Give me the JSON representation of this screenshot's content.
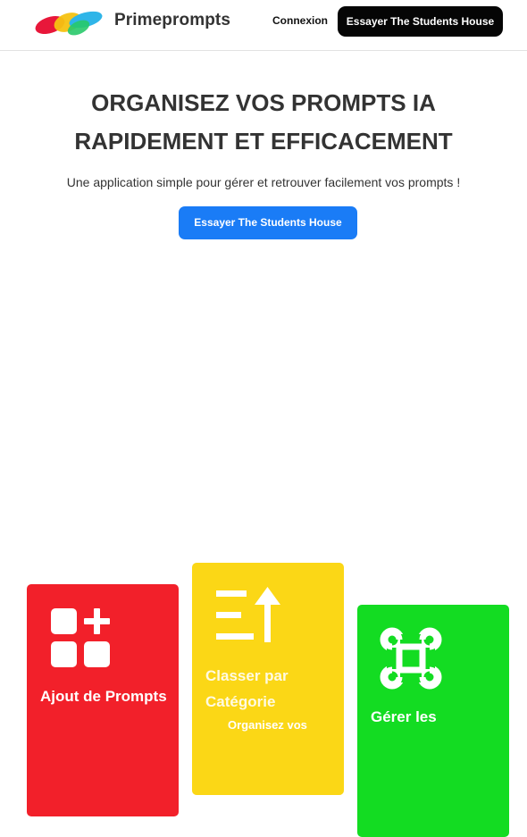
{
  "header": {
    "brand": "Primeprompts",
    "login_label": "Connexion",
    "cta_label": "Essayer The Students House"
  },
  "hero": {
    "title": "ORGANISEZ VOS PROMPTS IA RAPIDEMENT ET EFFICACEMENT",
    "subtitle": "Une application simple pour gérer et retrouver facilement vos prompts !",
    "cta_label": "Essayer The Students House"
  },
  "features": [
    {
      "title": "Ajout de Prompts",
      "icon": "add-grid-icon",
      "color": "#f2202a"
    },
    {
      "title": "Classer par Catégorie",
      "description": "Organisez vos",
      "icon": "sort-icon",
      "color": "#fbd716"
    },
    {
      "title": "Gérer les",
      "icon": "command-icon",
      "color": "#13dc22"
    }
  ],
  "colors": {
    "logo": [
      "#e8173a",
      "#f5c211",
      "#2fb5e8",
      "#28c96a"
    ],
    "primary_button": "#1a7cf6",
    "dark_button": "#050505"
  }
}
